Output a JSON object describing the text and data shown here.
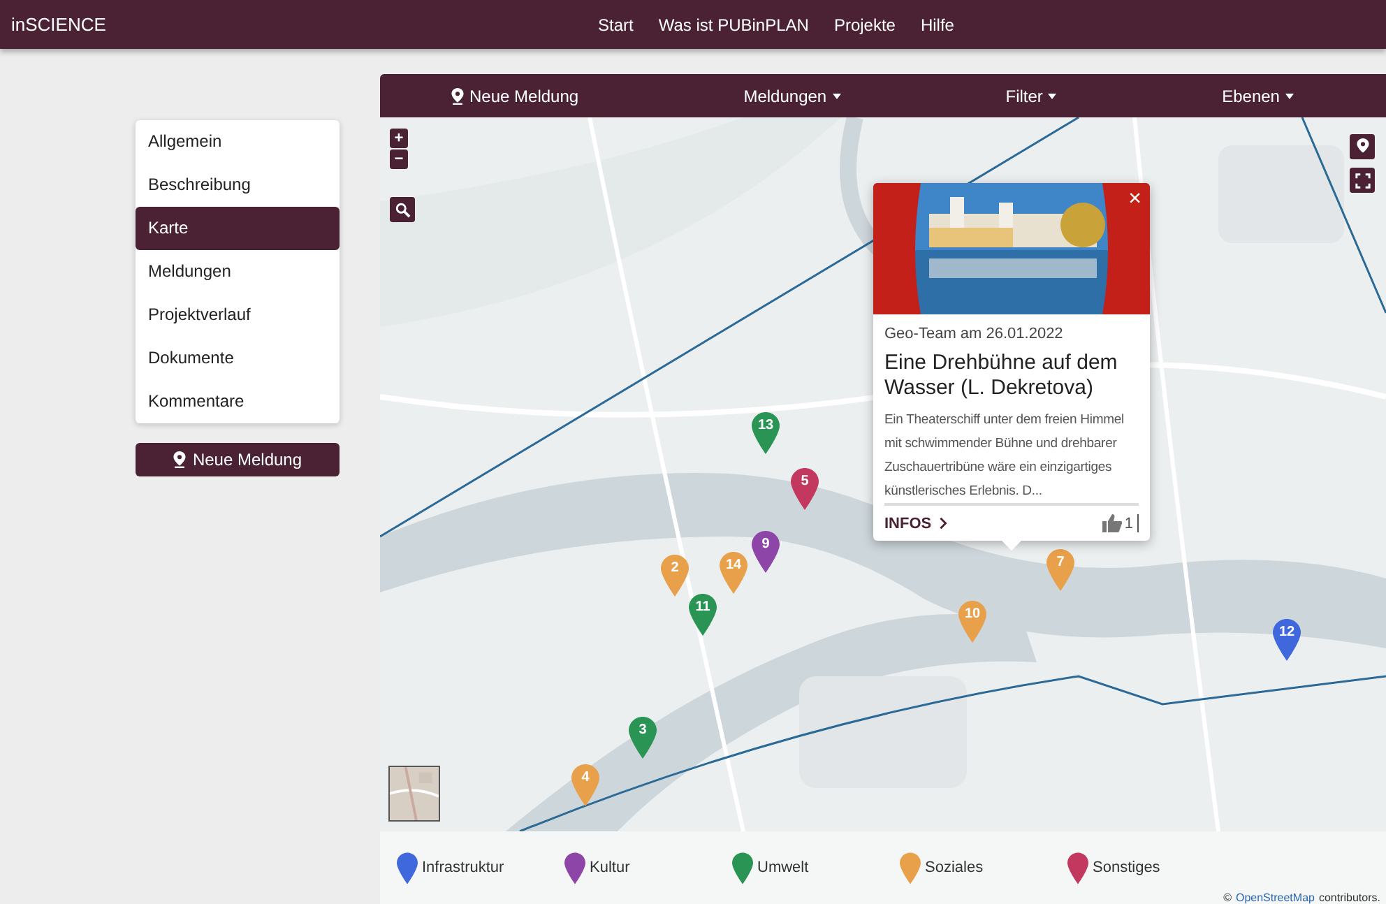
{
  "brand": "inSCIENCE",
  "nav": [
    {
      "label": "Start"
    },
    {
      "label": "Was ist PUBinPLAN"
    },
    {
      "label": "Projekte"
    },
    {
      "label": "Hilfe"
    }
  ],
  "map_toolbar": [
    {
      "label": "Neue Meldung",
      "kind": "action"
    },
    {
      "label": "Meldungen",
      "kind": "dropdown"
    },
    {
      "label": "Filter",
      "kind": "dropdown"
    },
    {
      "label": "Ebenen",
      "kind": "dropdown"
    }
  ],
  "sidebar": {
    "items": [
      {
        "label": "Allgemein",
        "selected": false
      },
      {
        "label": "Beschreibung",
        "selected": false
      },
      {
        "label": "Karte",
        "selected": true
      },
      {
        "label": "Meldungen",
        "selected": false
      },
      {
        "label": "Projektverlauf",
        "selected": false
      },
      {
        "label": "Dokumente",
        "selected": false
      },
      {
        "label": "Kommentare",
        "selected": false
      }
    ],
    "button": "Neue Meldung"
  },
  "map": {
    "zoom_in": "+",
    "zoom_out": "−",
    "markers": [
      {
        "number": "13",
        "color": "#2a9455"
      },
      {
        "number": "5",
        "color": "#c2385e"
      },
      {
        "number": "9",
        "color": "#8e45a8"
      },
      {
        "number": "2",
        "color": "#e9a04b"
      },
      {
        "number": "14",
        "color": "#e9a04b"
      },
      {
        "number": "11",
        "color": "#2a9455"
      },
      {
        "number": "7",
        "color": "#e9a04b"
      },
      {
        "number": "10",
        "color": "#e9a04b"
      },
      {
        "number": "12",
        "color": "#3f68dd"
      },
      {
        "number": "3",
        "color": "#2a9455"
      },
      {
        "number": "4",
        "color": "#e9a04b"
      }
    ],
    "popup": {
      "close": "×",
      "meta": "Geo-Team am 26.01.2022",
      "title": "Eine Drehbühne auf dem Wasser (L. Dekretova)",
      "text": "Ein Theaterschiff unter dem freien Himmel mit schwimmender Bühne und drehbarer Zuschauertribüne wäre ein einzigartiges künstlerisches Erlebnis. D...",
      "link": "INFOS",
      "likes": "1"
    },
    "legend": [
      {
        "label": "Infrastruktur",
        "color": "#3f68dd"
      },
      {
        "label": "Kultur",
        "color": "#8e45a8"
      },
      {
        "label": "Umwelt",
        "color": "#2a9455"
      },
      {
        "label": "Soziales",
        "color": "#e9a04b"
      },
      {
        "label": "Sonstiges",
        "color": "#c2385e"
      }
    ],
    "attribution": {
      "symbol": "©",
      "link": "OpenStreetMap",
      "text": "contributors."
    }
  }
}
